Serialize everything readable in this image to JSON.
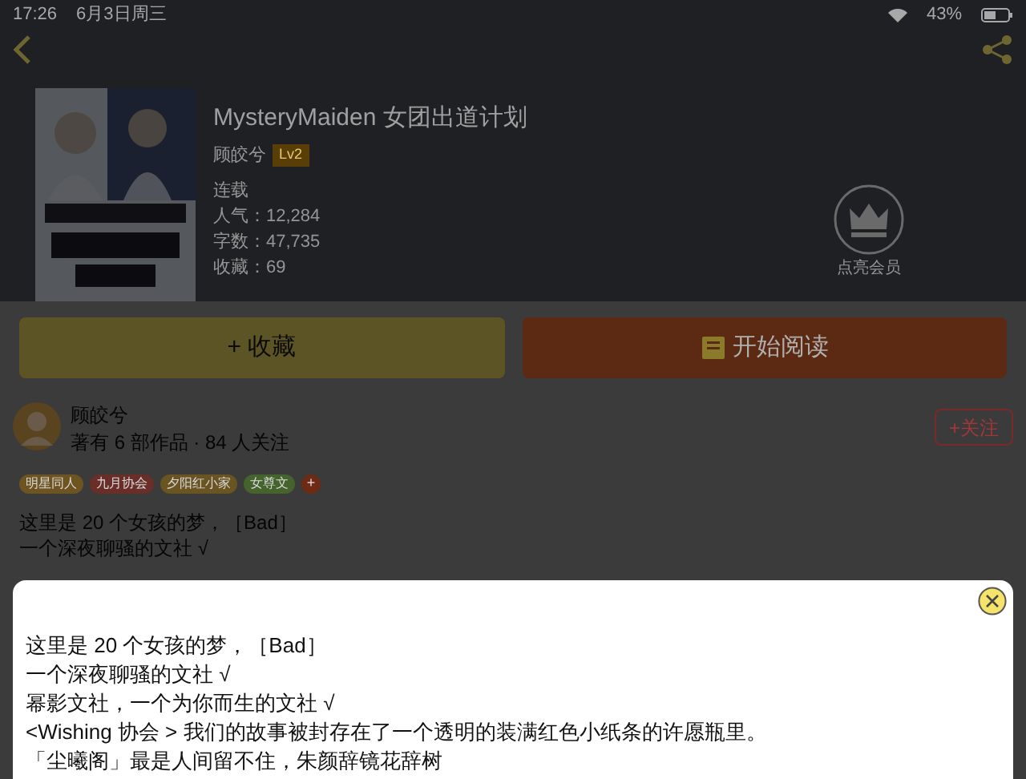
{
  "status_bar": {
    "time": "17:26",
    "date": "6月3日周三",
    "battery": "43%"
  },
  "book": {
    "title": "MysteryMaiden 女团出道计划",
    "author": "顾皎兮",
    "level": "Lv2",
    "status": "连载",
    "stats": [
      "人气：12,284",
      "字数：47,735",
      "收藏：69"
    ]
  },
  "member": {
    "label": "点亮会员"
  },
  "actions": [
    {
      "label": "+ 收藏",
      "kind": "collect"
    },
    {
      "label": "开始阅读",
      "kind": "read"
    }
  ],
  "author": {
    "name": "顾皎兮",
    "summary": "著有 6 部作品 · 84 人关注",
    "follow": "+关注"
  },
  "tags": [
    {
      "label": "明星同人",
      "color": "#6e5420"
    },
    {
      "label": "九月协会",
      "color": "#6a2e28"
    },
    {
      "label": "夕阳红小家",
      "color": "#6a5422"
    },
    {
      "label": "女尊文",
      "color": "#45632c"
    }
  ],
  "more_tag": "+",
  "intro": [
    "这里是 20 个女孩的梦，［Bad］",
    "一个深夜聊骚的文社 √"
  ],
  "modal": {
    "lines": [
      "这里是 20 个女孩的梦，［Bad］",
      "一个深夜聊骚的文社 √",
      "幂影文社，一个为你而生的文社 √",
      "<Wishing 协会 > 我们的故事被封存在了一个透明的装满红色小纸条的许愿瓶里。",
      "「尘曦阁」最是人间留不住，朱颜辞镜花辞树"
    ]
  }
}
